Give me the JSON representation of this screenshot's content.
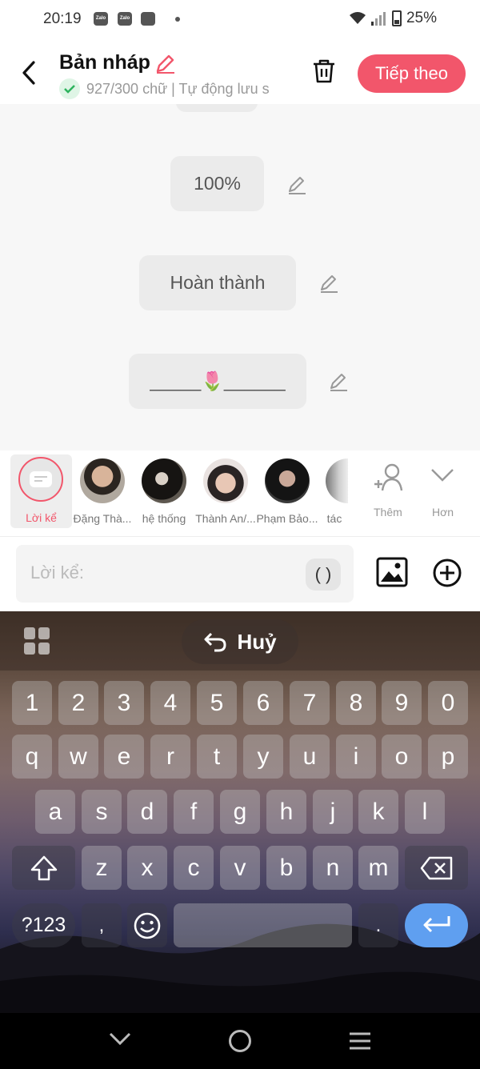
{
  "status_bar": {
    "time": "20:19",
    "apps": [
      "Zalo",
      "Zalo"
    ],
    "battery": "25%"
  },
  "header": {
    "title": "Bản nháp",
    "subtitle": "927/300 chữ | Tự động lưu s",
    "next_label": "Tiếp theo",
    "accent": "#f2566b"
  },
  "content": {
    "bubbles": [
      "100%",
      "Hoàn thành",
      "_____🌷______"
    ]
  },
  "characters": {
    "narrator_label": "Lời kể",
    "items": [
      "Đặng Thà...",
      "hệ thống",
      "Thành An/...",
      "Phạm Bảo...",
      "tác"
    ],
    "add_label": "Thêm",
    "more_label": "Hơn"
  },
  "input": {
    "placeholder": "Lời kể:",
    "paren_label": "( )"
  },
  "keyboard": {
    "undo_label": "Huỷ",
    "row_numbers": [
      "1",
      "2",
      "3",
      "4",
      "5",
      "6",
      "7",
      "8",
      "9",
      "0"
    ],
    "row1": [
      "q",
      "w",
      "e",
      "r",
      "t",
      "y",
      "u",
      "i",
      "o",
      "p"
    ],
    "row2": [
      "a",
      "s",
      "d",
      "f",
      "g",
      "h",
      "j",
      "k",
      "l"
    ],
    "row3": [
      "z",
      "x",
      "c",
      "v",
      "b",
      "n",
      "m"
    ],
    "symbols_label": "?123",
    "comma": ",",
    "period": "."
  }
}
